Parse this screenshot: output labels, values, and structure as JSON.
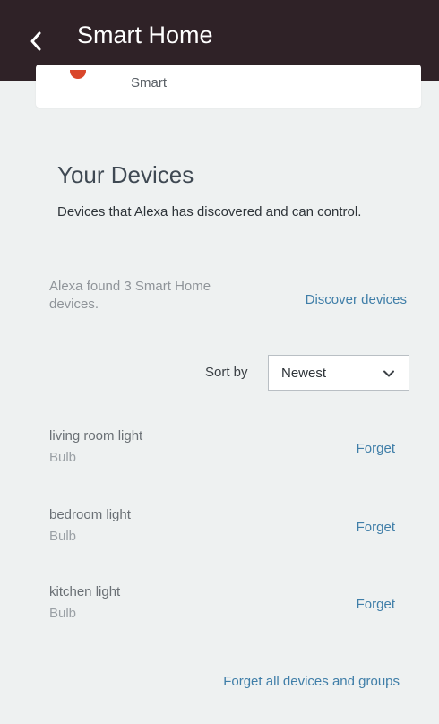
{
  "header": {
    "title": "Smart Home",
    "back_icon": "chevron-left-icon",
    "background": "#2f2227"
  },
  "top_card": {
    "label": "Smart"
  },
  "devices_section": {
    "title": "Your Devices",
    "description": "Devices that Alexa has discovered and can control.",
    "found_text": "Alexa found 3 Smart Home devices.",
    "discover_link": "Discover devices",
    "sort_label": "Sort by",
    "sort_selected": "Newest",
    "sort_icon": "chevron-down-icon",
    "items": [
      {
        "name": "living room light",
        "type": "Bulb",
        "action": "Forget"
      },
      {
        "name": "bedroom light",
        "type": "Bulb",
        "action": "Forget"
      },
      {
        "name": "kitchen light",
        "type": "Bulb",
        "action": "Forget"
      }
    ],
    "forget_all": "Forget all devices and groups"
  },
  "colors": {
    "link": "#3f7ea8",
    "background": "#eef1f1"
  }
}
